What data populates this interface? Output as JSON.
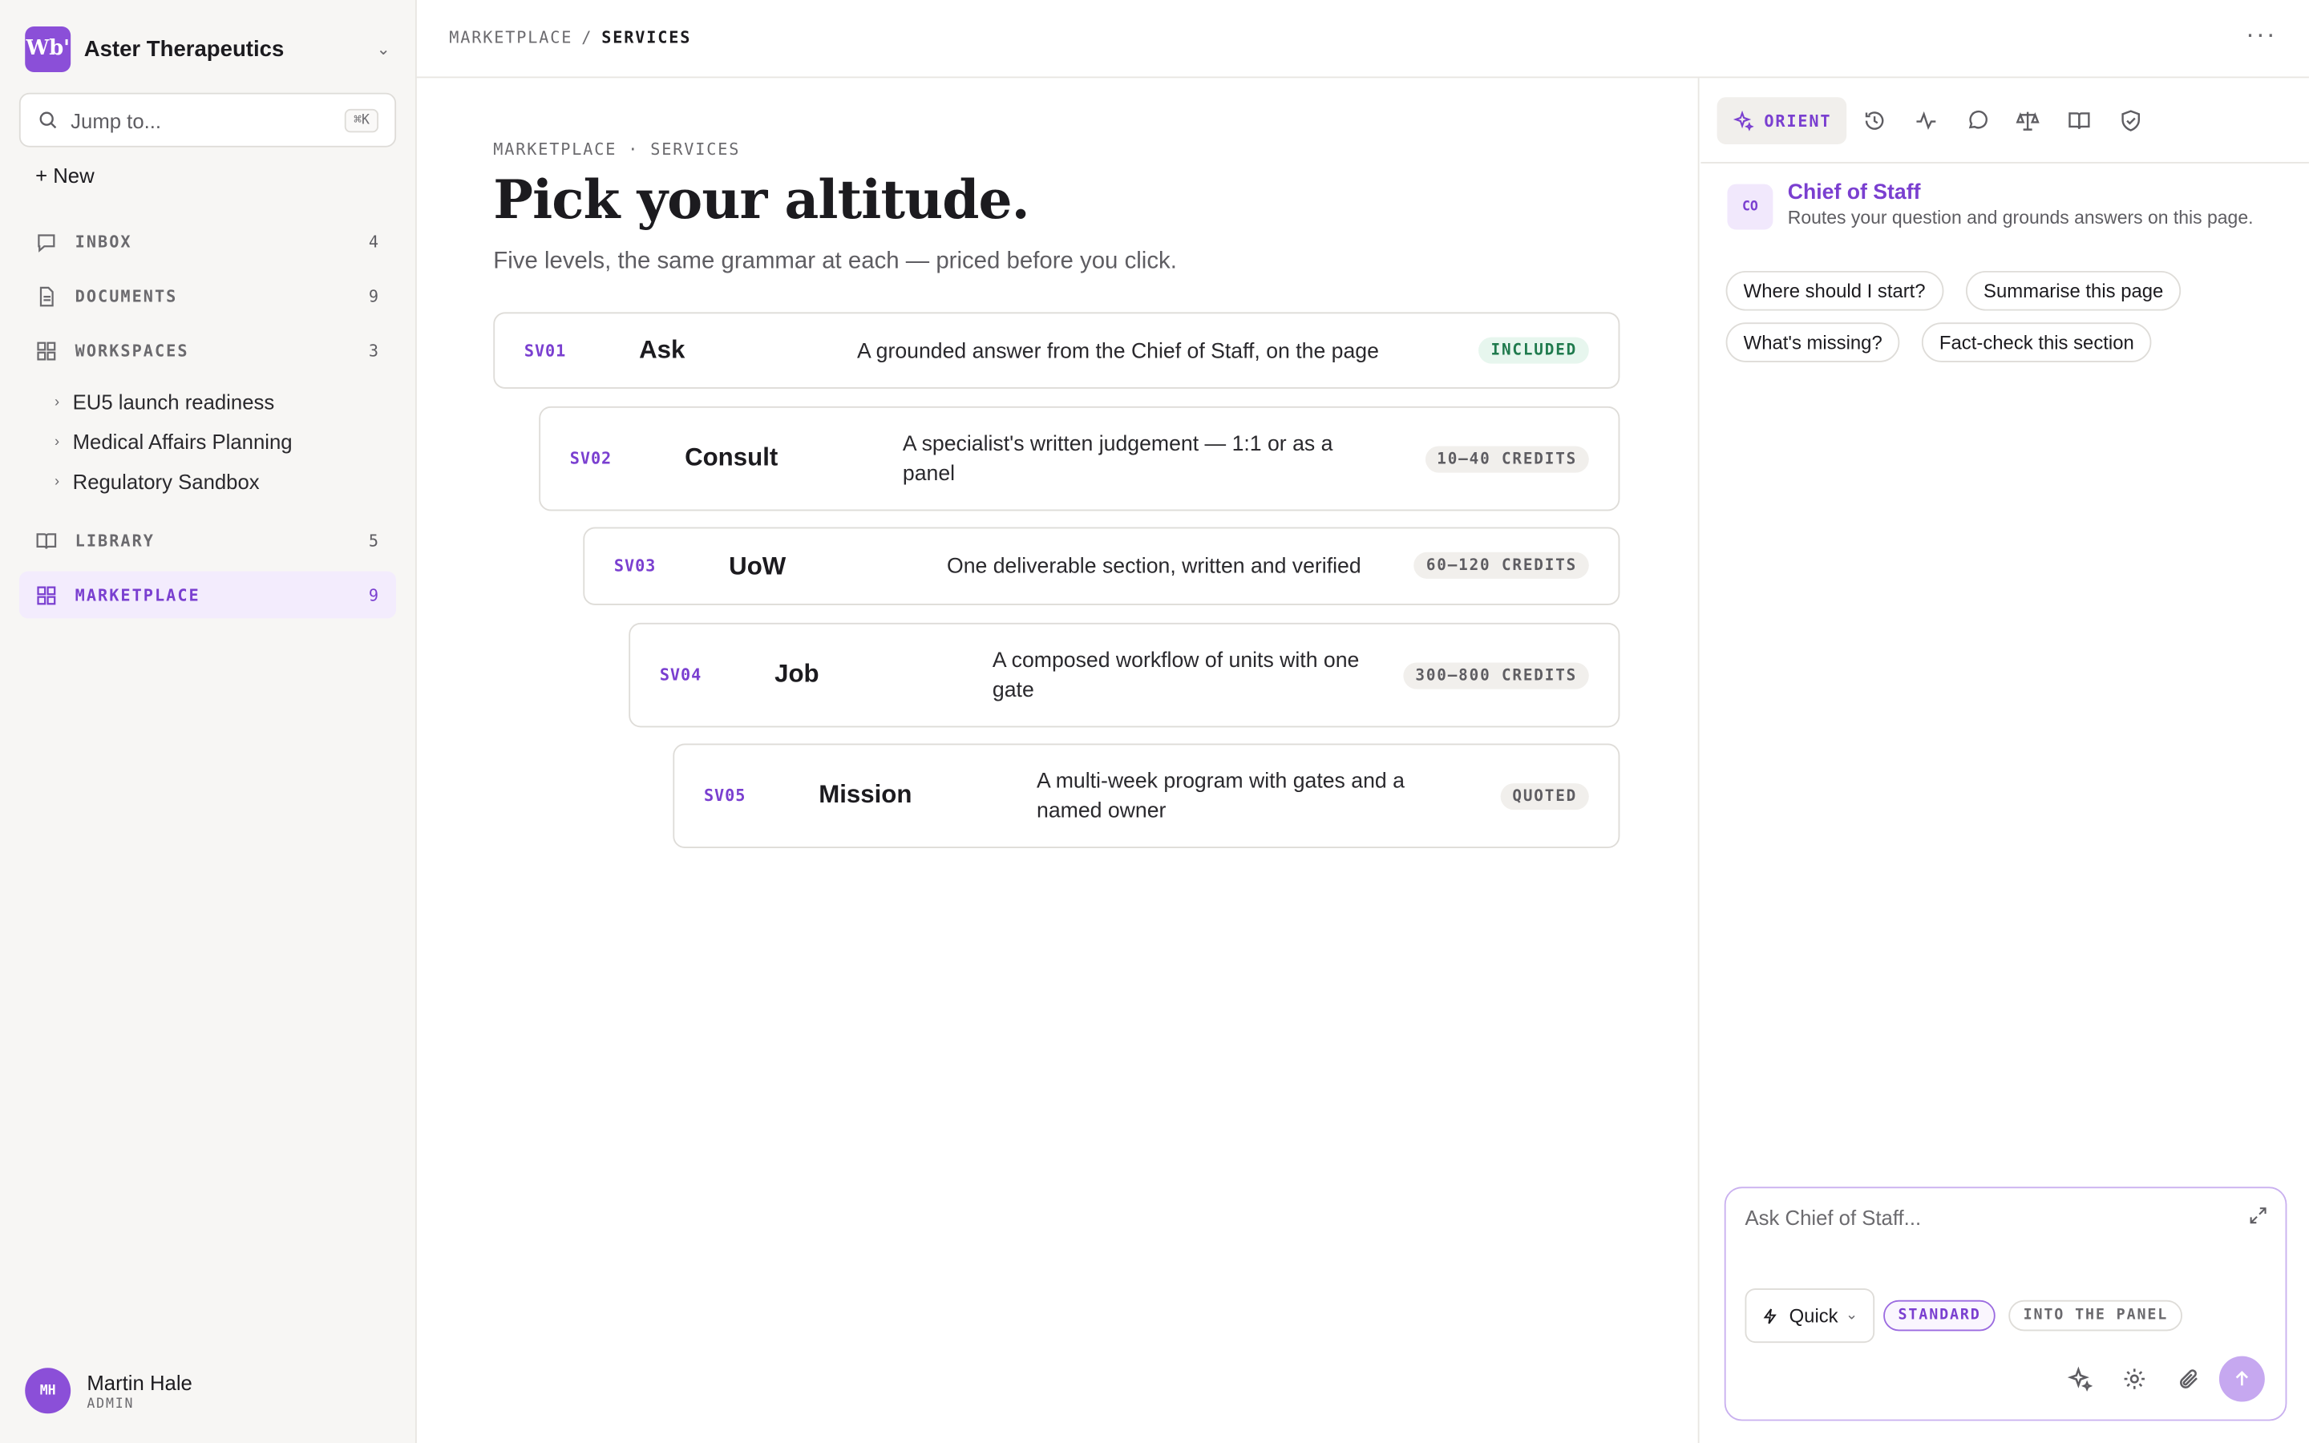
{
  "org": {
    "logo": "Wb'",
    "name": "Aster Therapeutics"
  },
  "search": {
    "placeholder": "Jump to...",
    "shortcut": "⌘K"
  },
  "new_label": "+ New",
  "nav": {
    "inbox": {
      "label": "INBOX",
      "count": "4"
    },
    "documents": {
      "label": "DOCUMENTS",
      "count": "9"
    },
    "workspaces": {
      "label": "WORKSPACES",
      "count": "3"
    },
    "library": {
      "label": "LIBRARY",
      "count": "5"
    },
    "marketplace": {
      "label": "MARKETPLACE",
      "count": "9"
    }
  },
  "workspaces": [
    "EU5 launch readiness",
    "Medical Affairs Planning",
    "Regulatory Sandbox"
  ],
  "user": {
    "initials": "MH",
    "name": "Martin Hale",
    "role": "ADMIN"
  },
  "breadcrumb": {
    "parent": "MARKETPLACE",
    "sep": "/",
    "current": "SERVICES"
  },
  "page": {
    "eyebrow": "MARKETPLACE · SERVICES",
    "title": "Pick your altitude.",
    "subtitle": "Five levels, the same grammar at each — priced before you click."
  },
  "services": [
    {
      "code": "SV01",
      "name": "Ask",
      "desc": "A grounded answer from the Chief of Staff, on the page",
      "price": "INCLUDED"
    },
    {
      "code": "SV02",
      "name": "Consult",
      "desc": "A specialist's written judgement — 1:1 or as a panel",
      "price": "10–40 CREDITS"
    },
    {
      "code": "SV03",
      "name": "UoW",
      "desc": "One deliverable section, written and verified",
      "price": "60–120 CREDITS"
    },
    {
      "code": "SV04",
      "name": "Job",
      "desc": "A composed workflow of units with one gate",
      "price": "300–800 CREDITS"
    },
    {
      "code": "SV05",
      "name": "Mission",
      "desc": "A multi-week program with gates and a named owner",
      "price": "QUOTED"
    }
  ],
  "panel": {
    "tab_label": "ORIENT",
    "agent_initials": "CO",
    "agent_name": "Chief of Staff",
    "agent_desc": "Routes your question and grounds answers on this page.",
    "suggestions": [
      "Where should I start?",
      "Summarise this page",
      "What's missing?",
      "Fact-check this section"
    ],
    "composer_placeholder": "Ask Chief of Staff...",
    "mode": "Quick",
    "pill_standard": "STANDARD",
    "pill_panel": "INTO THE PANEL"
  },
  "colors": {
    "accent": "#7a3fd0",
    "brand": "#8b4fd8",
    "included": "#1f7a4d"
  }
}
